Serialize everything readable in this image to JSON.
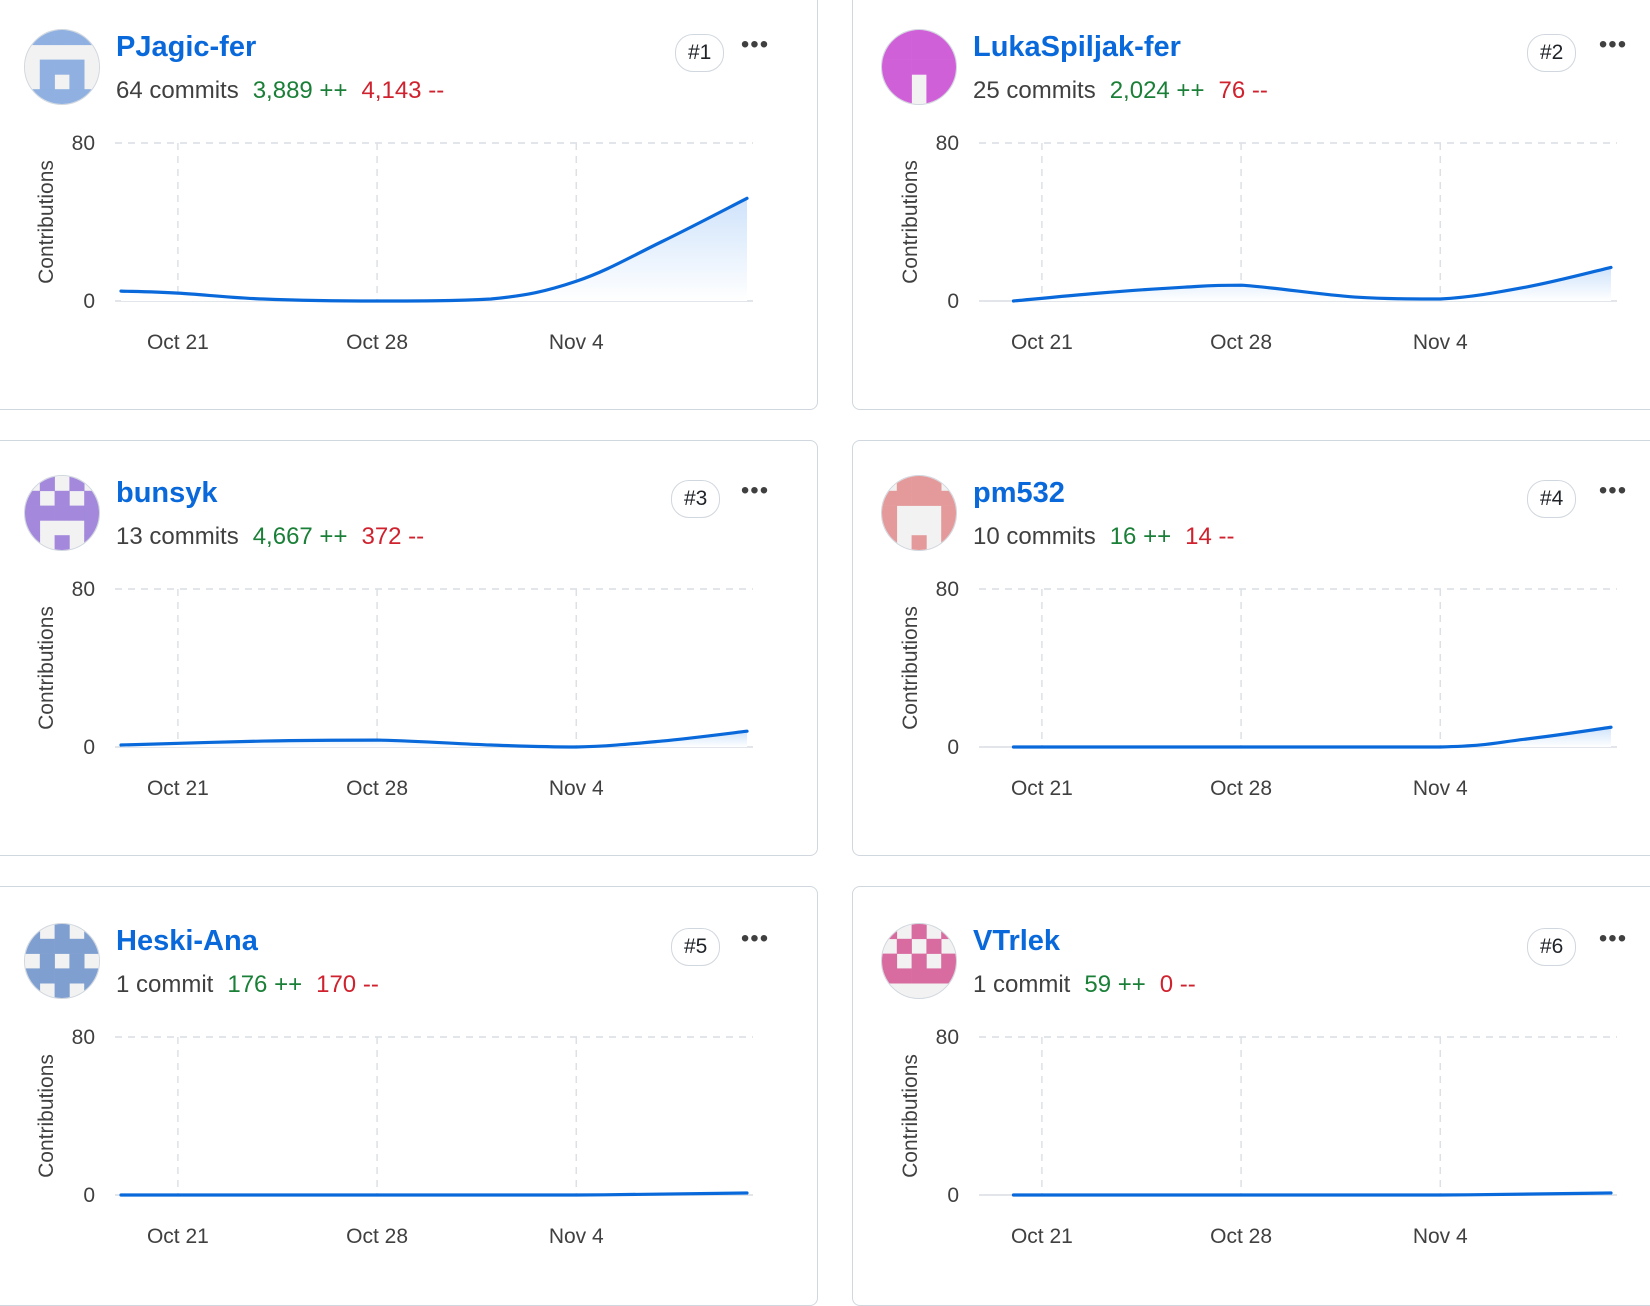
{
  "axis": {
    "y_label": "Contributions",
    "y_ticks": [
      "0",
      "80"
    ],
    "x_ticks": [
      "Oct 21",
      "Oct 28",
      "Nov 4"
    ]
  },
  "more_label": "•••",
  "colors": {
    "link": "#0969da",
    "additions": "#1a7f37",
    "deletions": "#cf222e",
    "line": "#0969da",
    "fill": "#cfe3fb"
  },
  "contributors": [
    {
      "username": "PJagic-fer",
      "rank": "#1",
      "commits": "64 commits",
      "additions": "3,889 ++",
      "deletions": "4,143 --",
      "avatar_color": "#8fb0e0"
    },
    {
      "username": "LukaSpiljak-fer",
      "rank": "#2",
      "commits": "25 commits",
      "additions": "2,024 ++",
      "deletions": "76 --",
      "avatar_color": "#d060d8"
    },
    {
      "username": "bunsyk",
      "rank": "#3",
      "commits": "13 commits",
      "additions": "4,667 ++",
      "deletions": "372 --",
      "avatar_color": "#a388dc"
    },
    {
      "username": "pm532",
      "rank": "#4",
      "commits": "10 commits",
      "additions": "16 ++",
      "deletions": "14 --",
      "avatar_color": "#e49a9a"
    },
    {
      "username": "Heski-Ana",
      "rank": "#5",
      "commits": "1 commit",
      "additions": "176 ++",
      "deletions": "170 --",
      "avatar_color": "#7f9fd0"
    },
    {
      "username": "VTrlek",
      "rank": "#6",
      "commits": "1 commit",
      "additions": "59 ++",
      "deletions": "0 --",
      "avatar_color": "#d86ca0"
    }
  ],
  "chart_data": [
    {
      "type": "area",
      "series_of": "PJagic-fer",
      "ylabel": "Contributions",
      "ylim": [
        0,
        80
      ],
      "x": [
        "Oct 19",
        "Oct 21",
        "Oct 24",
        "Oct 28",
        "Nov 1",
        "Nov 4",
        "Nov 7",
        "Nov 10"
      ],
      "values": [
        5,
        4,
        1,
        0,
        1,
        10,
        30,
        52
      ]
    },
    {
      "type": "area",
      "series_of": "LukaSpiljak-fer",
      "ylabel": "Contributions",
      "ylim": [
        0,
        80
      ],
      "x": [
        "Oct 20",
        "Oct 23",
        "Oct 26",
        "Oct 28",
        "Nov 1",
        "Nov 4",
        "Nov 7",
        "Nov 10"
      ],
      "values": [
        0,
        4,
        7,
        8,
        2,
        1,
        7,
        17
      ]
    },
    {
      "type": "area",
      "series_of": "bunsyk",
      "ylabel": "Contributions",
      "ylim": [
        0,
        80
      ],
      "x": [
        "Oct 19",
        "Oct 24",
        "Oct 28",
        "Nov 1",
        "Nov 4",
        "Nov 7",
        "Nov 10"
      ],
      "values": [
        1,
        3,
        3.5,
        1,
        0,
        3,
        8
      ]
    },
    {
      "type": "area",
      "series_of": "pm532",
      "ylabel": "Contributions",
      "ylim": [
        0,
        80
      ],
      "x": [
        "Oct 20",
        "Oct 28",
        "Nov 4",
        "Nov 7",
        "Nov 10"
      ],
      "values": [
        0,
        0,
        0,
        4,
        10
      ]
    },
    {
      "type": "area",
      "series_of": "Heski-Ana",
      "ylabel": "Contributions",
      "ylim": [
        0,
        80
      ],
      "x": [
        "Oct 19",
        "Oct 28",
        "Nov 4",
        "Nov 10"
      ],
      "values": [
        0,
        0,
        0,
        1
      ]
    },
    {
      "type": "area",
      "series_of": "VTrlek",
      "ylabel": "Contributions",
      "ylim": [
        0,
        80
      ],
      "x": [
        "Oct 20",
        "Oct 28",
        "Nov 4",
        "Nov 10"
      ],
      "values": [
        0,
        0,
        0,
        1
      ]
    }
  ]
}
